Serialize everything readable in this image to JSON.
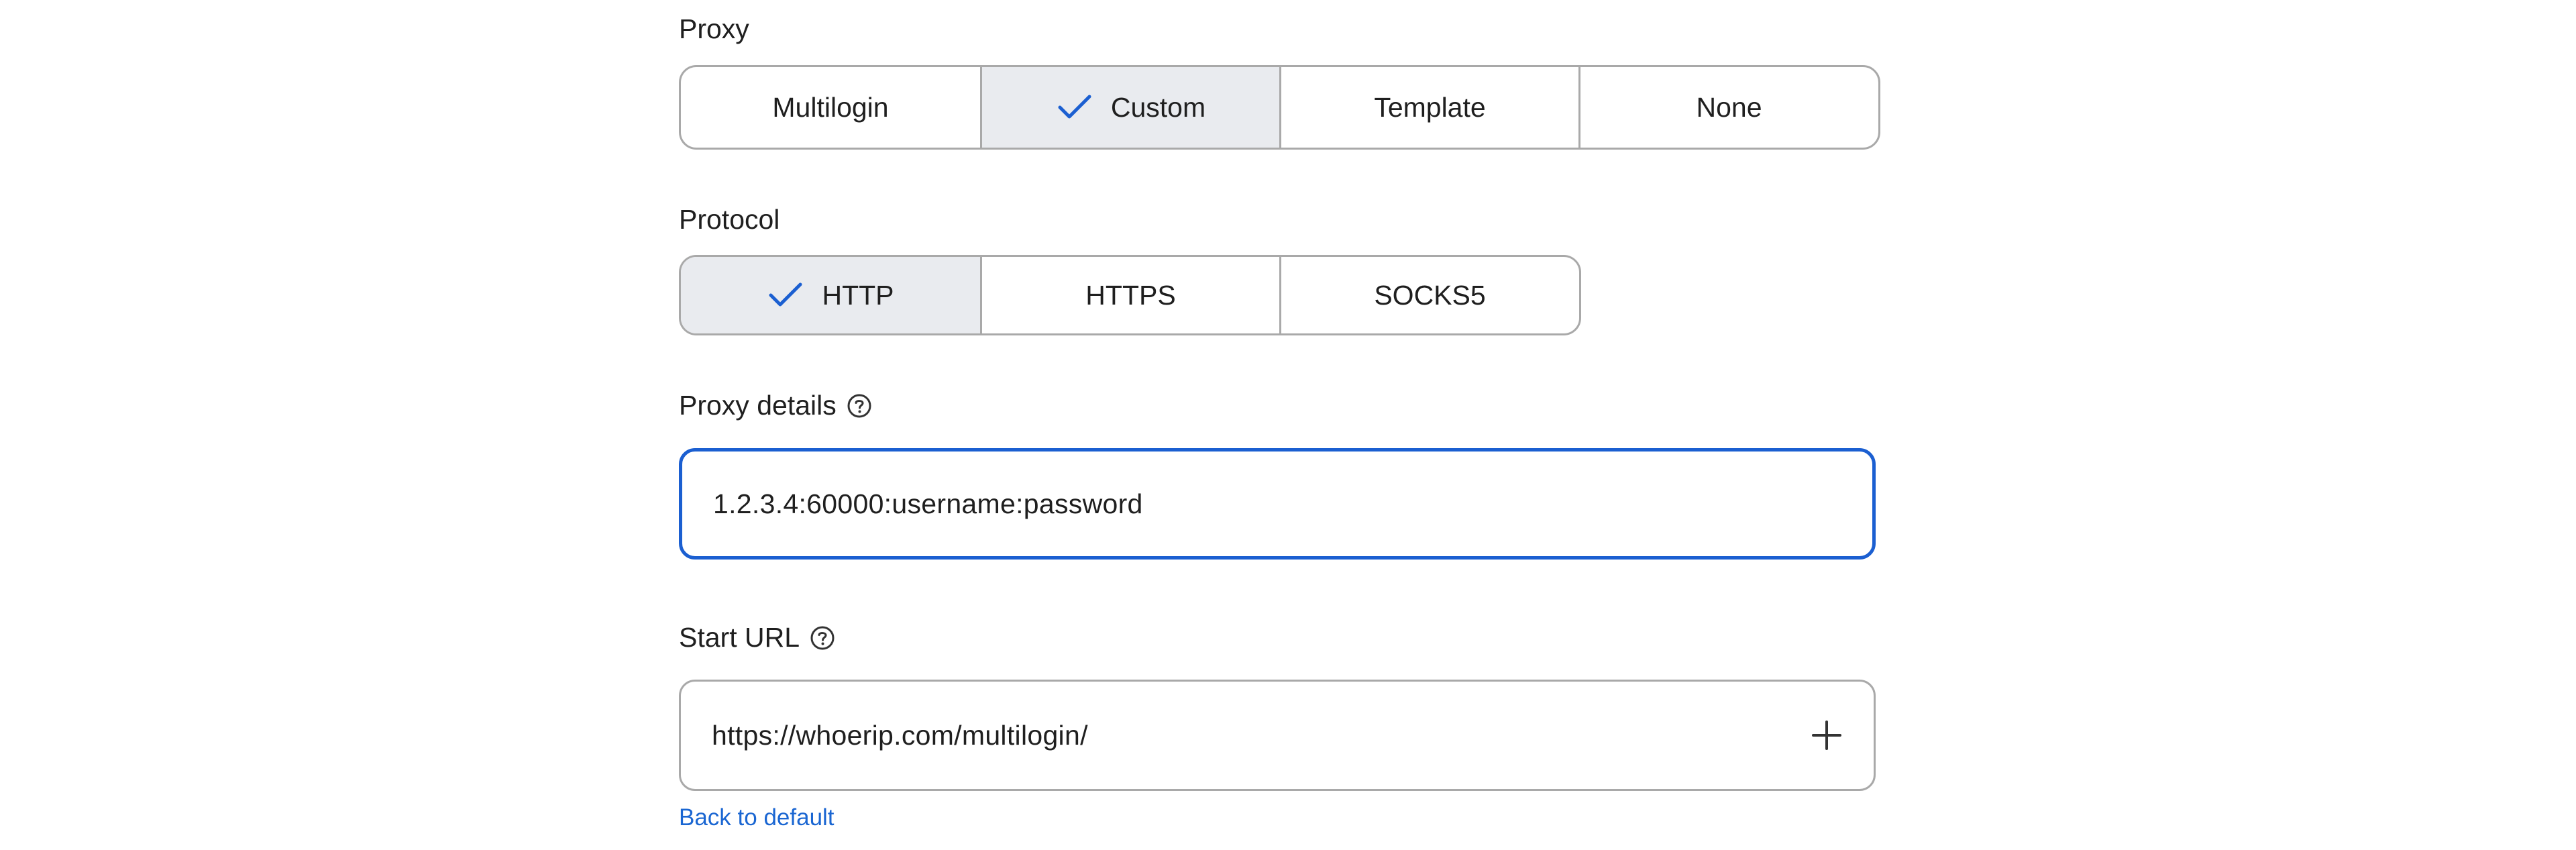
{
  "proxy": {
    "label": "Proxy",
    "options": [
      "Multilogin",
      "Custom",
      "Template",
      "None"
    ],
    "selected": "Custom"
  },
  "protocol": {
    "label": "Protocol",
    "options": [
      "HTTP",
      "HTTPS",
      "SOCKS5"
    ],
    "selected": "HTTP"
  },
  "proxy_details": {
    "label": "Proxy details",
    "value": "1.2.3.4:60000:username:password",
    "help_icon": "question-circle-icon"
  },
  "start_url": {
    "label": "Start URL",
    "value": "https://whoerip.com/multilogin/",
    "help_icon": "question-circle-icon",
    "add_icon": "plus-icon"
  },
  "back_to_default": "Back to default",
  "colors": {
    "accent": "#1b5fd1",
    "link": "#1a66d2",
    "selected_bg": "#e9ebef",
    "border": "#a9a9a9"
  }
}
